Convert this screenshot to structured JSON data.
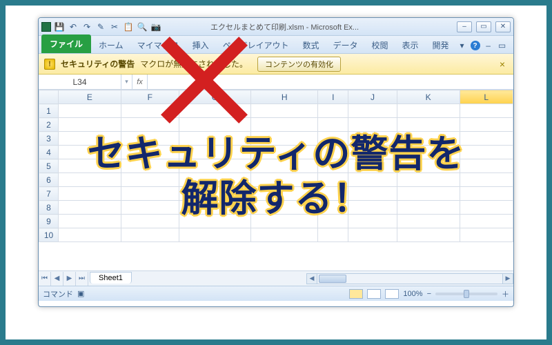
{
  "window": {
    "title": "エクセルまとめて印刷.xlsm - Microsoft Ex...",
    "min": "–",
    "max": "▭",
    "close": "✕"
  },
  "qat": [
    "💾",
    "↶",
    "↷",
    "✎",
    "✂",
    "📋",
    "🔍",
    "📷"
  ],
  "ribbon": {
    "file": "ファイル",
    "tabs": [
      "ホーム",
      "マイマクロ",
      "挿入",
      "ページレイアウト",
      "数式",
      "データ",
      "校閲",
      "表示",
      "開発"
    ]
  },
  "security": {
    "title": "セキュリティの警告",
    "msg": "マクロが無効にされました。",
    "button": "コンテンツの有効化",
    "close": "×"
  },
  "namebox": "L34",
  "fx": "fx",
  "columns": [
    "E",
    "F",
    "G",
    "H",
    "I",
    "J",
    "K",
    "L"
  ],
  "selected_col": "L",
  "rows": [
    "1",
    "2",
    "3",
    "4",
    "5",
    "6",
    "7",
    "8",
    "9",
    "10"
  ],
  "sheet": {
    "nav": [
      "⏮",
      "◀",
      "▶",
      "⏭"
    ],
    "tab": "Sheet1"
  },
  "status": {
    "label": "コマンド",
    "zoom": "100%",
    "minus": "−",
    "plus": "＋"
  },
  "overlay": {
    "line1": "セキュリティの警告を",
    "line2": "解除する！"
  }
}
